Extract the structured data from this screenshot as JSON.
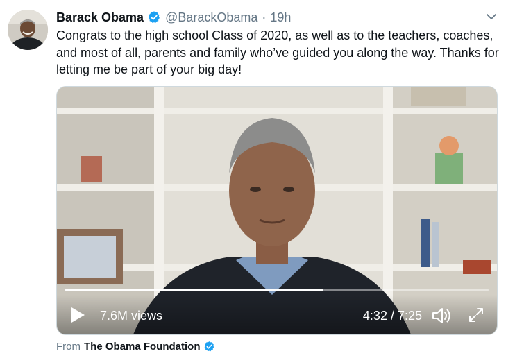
{
  "tweet": {
    "author": {
      "name": "Barack Obama",
      "handle": "@BarackObama",
      "verified": true
    },
    "separator": "·",
    "timestamp": "19h",
    "text": "Congrats to the high school Class of 2020, as well as to the teachers, coaches, and most of all, parents and family who’ve guided you along the way. Thanks for letting me be part of your big day!",
    "video": {
      "views": "7.6M views",
      "timecode": "4:32 / 7:25",
      "progress_fraction": 0.61
    },
    "source": {
      "prefix": "From",
      "name": "The Obama Foundation",
      "verified": true
    }
  },
  "colors": {
    "verified_blue": "#1da1f2",
    "secondary_text": "#657786",
    "primary_text": "#0f1419"
  },
  "icons": {
    "caret": "chevron-down-icon",
    "play": "play-icon",
    "volume": "volume-icon",
    "fullscreen": "fullscreen-icon",
    "verified": "verified-badge-icon"
  }
}
